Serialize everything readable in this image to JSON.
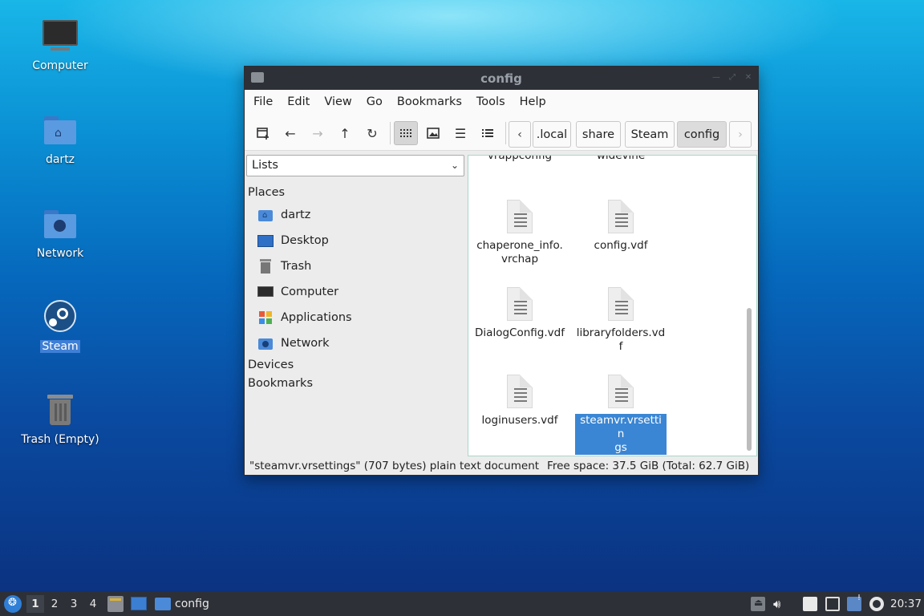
{
  "desktop": {
    "icons": [
      {
        "label": "Computer"
      },
      {
        "label": "dartz"
      },
      {
        "label": "Network"
      },
      {
        "label": "Steam"
      },
      {
        "label": "Trash (Empty)"
      }
    ]
  },
  "window": {
    "title": "config",
    "menu": [
      "File",
      "Edit",
      "View",
      "Go",
      "Bookmarks",
      "Tools",
      "Help"
    ],
    "breadcrumbs": [
      ".local",
      "share",
      "Steam",
      "config"
    ],
    "sidebar": {
      "selector": "Lists",
      "places_header": "Places",
      "places": [
        "dartz",
        "Desktop",
        "Trash",
        "Computer",
        "Applications",
        "Network"
      ],
      "devices_header": "Devices",
      "bookmarks_header": "Bookmarks"
    },
    "files_partial": [
      "vrappconfig",
      "widevine"
    ],
    "files": [
      {
        "name": "chaperone_info.\nvrchap"
      },
      {
        "name": "config.vdf"
      },
      {
        "name": "DialogConfig.vdf"
      },
      {
        "name": "libraryfolders.vd\nf"
      },
      {
        "name": "loginusers.vdf"
      },
      {
        "name": "steamvr.vrsettin\ngs"
      }
    ],
    "status": {
      "selection": "\"steamvr.vrsettings\" (707 bytes) plain text document",
      "space": "Free space: 37.5 GiB (Total: 62.7 GiB)"
    }
  },
  "taskbar": {
    "workspaces": [
      "1",
      "2",
      "3",
      "4"
    ],
    "task_label": "config",
    "clock": "20:37"
  },
  "colors": {
    "selection": "#3a86d4",
    "panel": "#2d3037"
  }
}
